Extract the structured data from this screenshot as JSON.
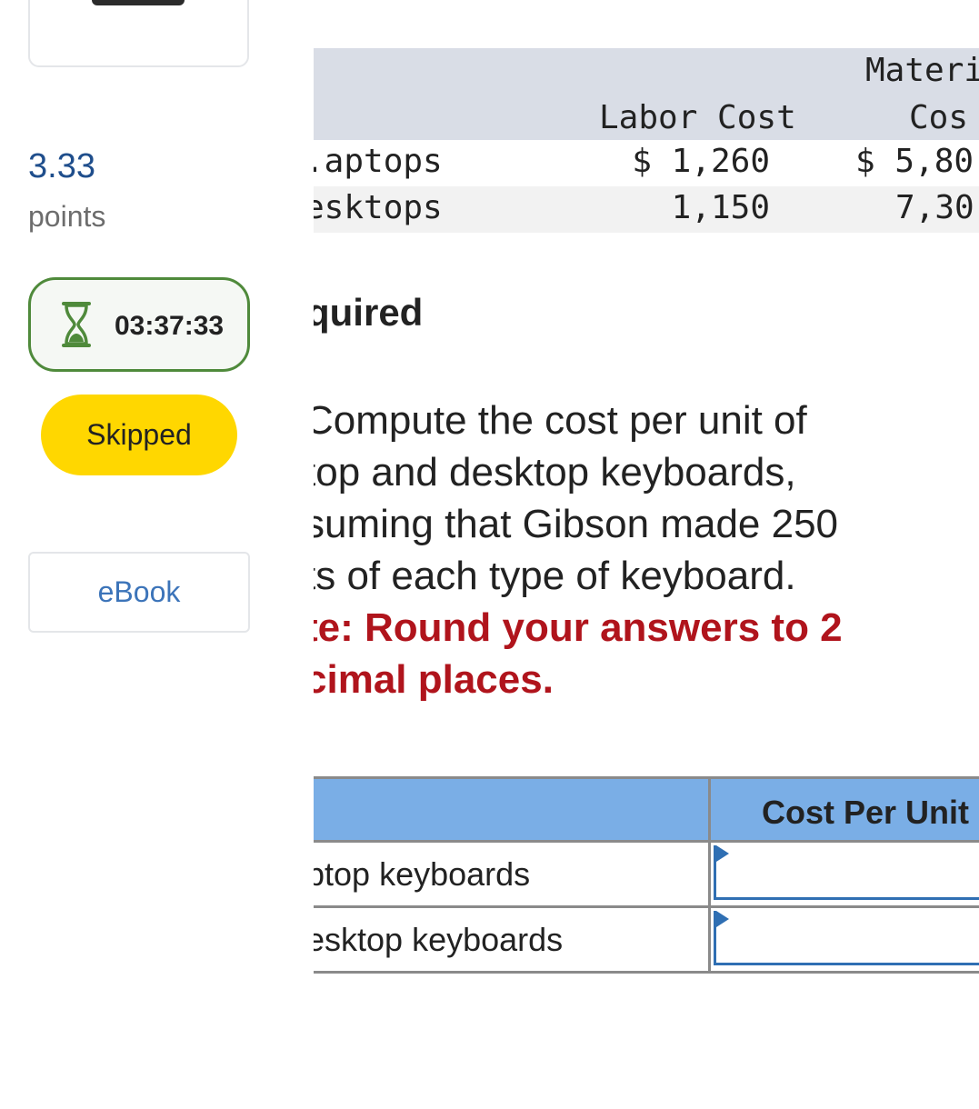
{
  "sidebar": {
    "points_value": "3.33",
    "points_label": "points",
    "timer": "03:37:33",
    "status_label": "Skipped",
    "ebook_label": "eBook"
  },
  "data_table": {
    "header_top_right": "Materi",
    "header_labor": "Labor Cost",
    "header_material": "Cos",
    "rows": [
      {
        "label": ".aptops",
        "labor": "$ 1,260",
        "material": "$ 5,80"
      },
      {
        "label": "esktops",
        "labor": "1,150",
        "material": "7,30"
      }
    ]
  },
  "required": {
    "heading": "quired",
    "lines": [
      "Compute the cost per unit of",
      "top and desktop keyboards,",
      "suming that Gibson made 250",
      "ts of each type of keyboard."
    ],
    "note_lines": [
      "te: Round your answers to 2",
      "cimal places."
    ]
  },
  "answer_table": {
    "column_header": "Cost Per Unit",
    "rows": [
      {
        "label": "ptop keyboards",
        "value": ""
      },
      {
        "label": "esktop keyboards",
        "value": ""
      }
    ]
  },
  "colors": {
    "points": "#1f4e8c",
    "timer_border": "#4f8a3b",
    "skipped_bg": "#ffd700",
    "ebook_text": "#3c74b9",
    "note_red": "#b0141c",
    "answer_header_bg": "#7aaee6",
    "table_header_bg": "#d9dde6"
  }
}
